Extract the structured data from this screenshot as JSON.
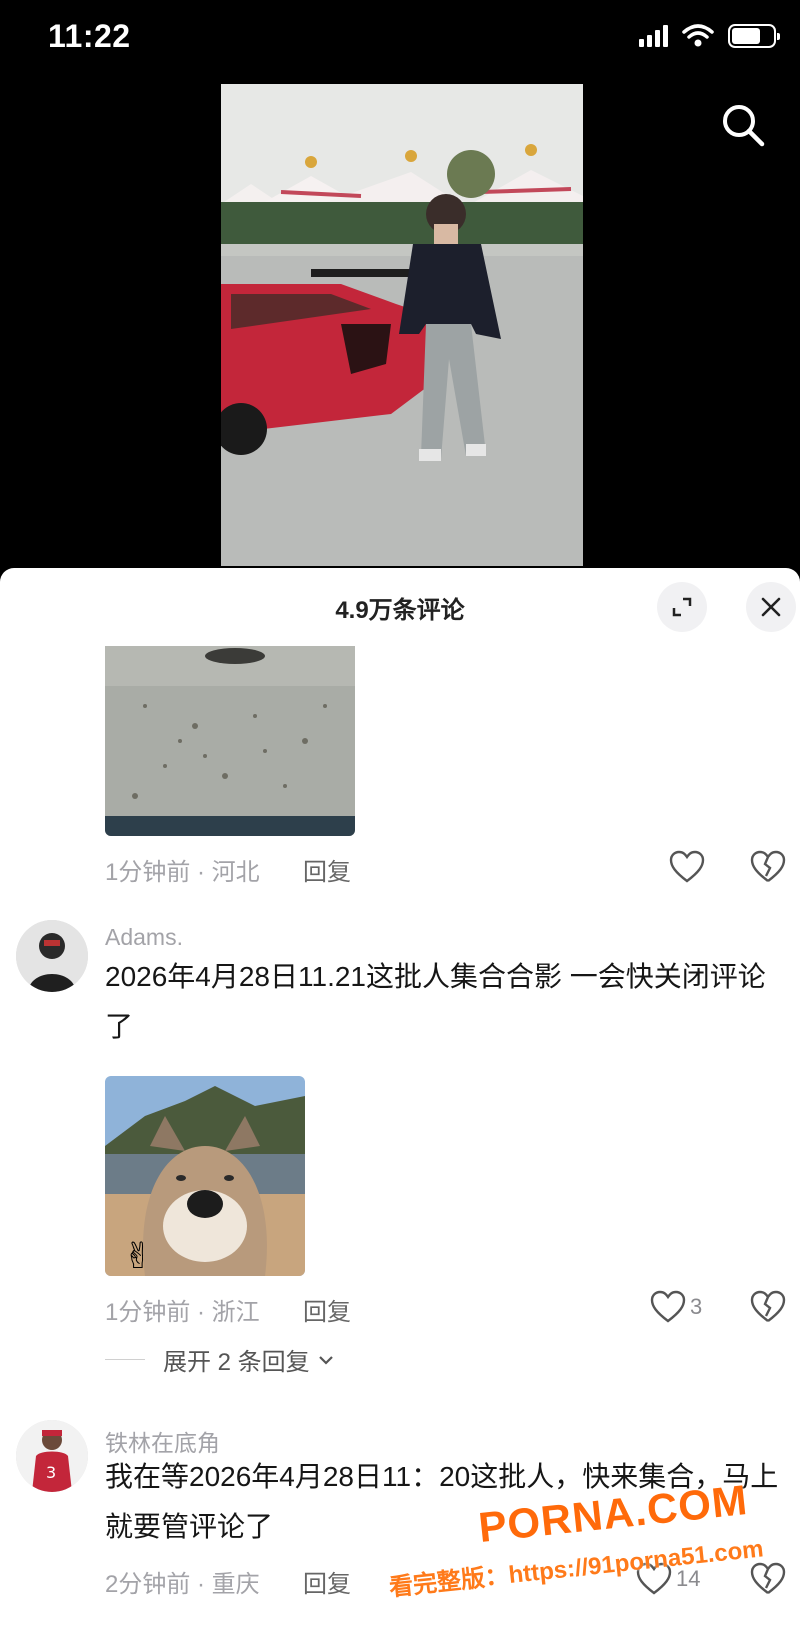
{
  "status_bar": {
    "time": "11:22",
    "icons": [
      "signal-icon",
      "wifi-icon",
      "battery-icon"
    ]
  },
  "search": {
    "icon": "search-icon"
  },
  "sheet": {
    "title": "4.9万条评论",
    "expand_icon": "expand-icon",
    "close_icon": "close-icon"
  },
  "comments": [
    {
      "image": "dirt-ground-photo",
      "time_location": "1分钟前 · 河北",
      "reply_label": "回复",
      "like_count": "",
      "colors": {
        "text": "#161616",
        "meta": "#a3a3a8"
      }
    },
    {
      "username": "Adams.",
      "text": "2026年4月28日11.21这批人集合合影 一会快关闭评论了",
      "image": "dog-selfie-photo",
      "time_location": "1分钟前 · 浙江",
      "reply_label": "回复",
      "like_count": "3",
      "expand_replies": "展开 2 条回复"
    },
    {
      "username": "铁林在底角",
      "text": "我在等2026年4月28日11：20这批人，快来集合，马上就要管评论了",
      "time_location": "2分钟前 · 重庆",
      "reply_label": "回复",
      "like_count": "14"
    }
  ],
  "watermark": {
    "main": "PORNA.COM",
    "sub": "看完整版：https://91porna51.com"
  }
}
